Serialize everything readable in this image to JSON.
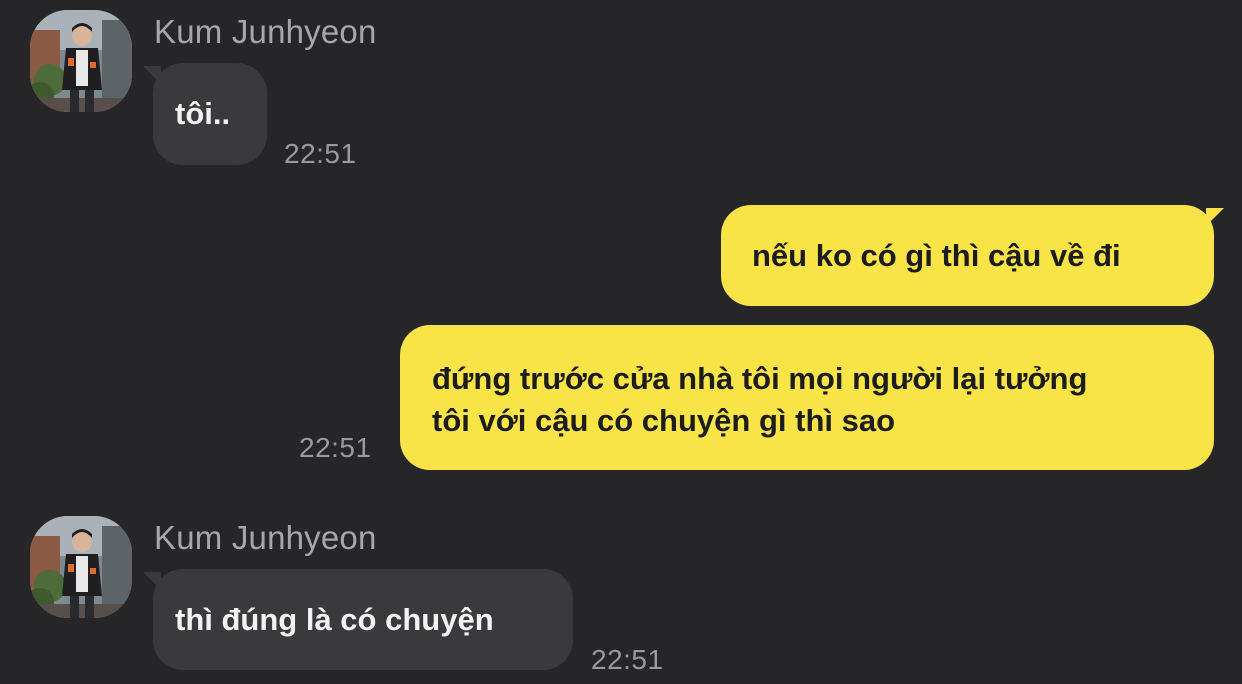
{
  "chat": {
    "messages": [
      {
        "direction": "incoming",
        "sender": "Kum Junhyeon",
        "lines": [
          "tôi.."
        ],
        "time": "22:51"
      },
      {
        "direction": "outgoing",
        "lines": [
          "nếu ko có gì thì cậu về đi"
        ],
        "time": ""
      },
      {
        "direction": "outgoing",
        "lines": [
          "đứng trước cửa nhà tôi mọi người lại tưởng",
          "tôi với cậu có chuyện gì thì sao"
        ],
        "time": "22:51"
      },
      {
        "direction": "incoming",
        "sender": "Kum Junhyeon",
        "lines": [
          "thì đúng là có chuyện"
        ],
        "time": "22:51"
      }
    ]
  },
  "colors": {
    "background": "#262628",
    "incoming_bubble": "#3a3a3c",
    "outgoing_bubble": "#f9e448"
  },
  "icons": {
    "avatar": "profile-photo"
  }
}
